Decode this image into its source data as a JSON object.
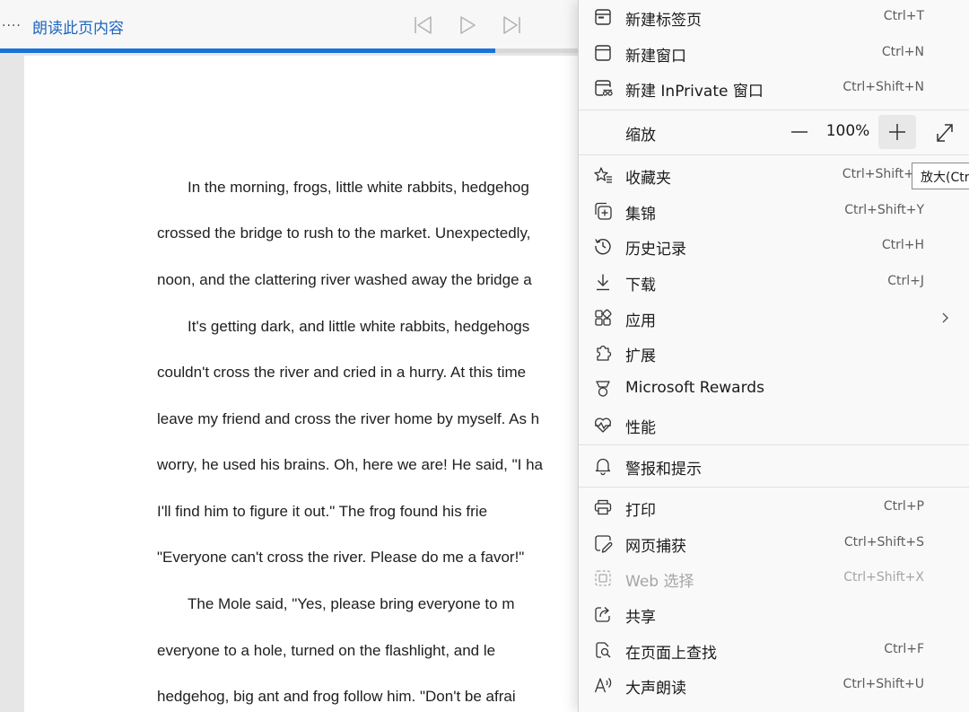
{
  "toolbar": {
    "more_label": "....",
    "read_aloud_label": "朗读此页内容",
    "progress_percent": 92
  },
  "document": {
    "lines": [
      "In the morning, frogs, little white rabbits, hedgehog",
      "crossed the bridge to rush to the market. Unexpectedly,",
      "noon, and the clattering river washed away the bridge a",
      "It's getting dark, and little white rabbits, hedgehogs",
      "couldn't cross the river and cried in a hurry. At this time",
      "leave my friend and cross the river home by myself. As h",
      "worry, he used his brains. Oh, here we are! He said, \"I ha",
      "I'll find him to figure it out.\" The frog found his frie",
      "\"Everyone can't cross the river. Please do me a favor!\"",
      "The Mole said, \"Yes, please bring everyone to m",
      "everyone to a hole, turned on the flashlight, and le",
      "hedgehog, big ant and frog follow him. \"Don't be afrai"
    ]
  },
  "menu": {
    "new_tab": {
      "label": "新建标签页",
      "shortcut": "Ctrl+T"
    },
    "new_window": {
      "label": "新建窗口",
      "shortcut": "Ctrl+N"
    },
    "new_inprivate": {
      "label": "新建 InPrivate 窗口",
      "shortcut": "Ctrl+Shift+N"
    },
    "zoom": {
      "label": "缩放",
      "value": "100%"
    },
    "favorites": {
      "label": "收藏夹",
      "shortcut": "Ctrl+Shift+"
    },
    "collections": {
      "label": "集锦",
      "shortcut": "Ctrl+Shift+Y"
    },
    "history": {
      "label": "历史记录",
      "shortcut": "Ctrl+H"
    },
    "downloads": {
      "label": "下载",
      "shortcut": "Ctrl+J"
    },
    "apps": {
      "label": "应用"
    },
    "extensions": {
      "label": "扩展"
    },
    "rewards": {
      "label": "Microsoft Rewards"
    },
    "performance": {
      "label": "性能"
    },
    "alerts": {
      "label": "警报和提示"
    },
    "print": {
      "label": "打印",
      "shortcut": "Ctrl+P"
    },
    "web_capture": {
      "label": "网页捕获",
      "shortcut": "Ctrl+Shift+S"
    },
    "web_select": {
      "label": "Web 选择",
      "shortcut": "Ctrl+Shift+X"
    },
    "share": {
      "label": "共享"
    },
    "find": {
      "label": "在页面上查找",
      "shortcut": "Ctrl+F"
    },
    "read_aloud": {
      "label": "大声朗读",
      "shortcut": "Ctrl+Shift+U"
    }
  },
  "tooltip": {
    "text": "放大(Ctr"
  },
  "colors": {
    "accent": "#1a73d9",
    "link_text": "#1e66c4",
    "menu_bg": "#f9f9f9",
    "disabled_text": "#a5a5a5"
  },
  "icons": {
    "toolbar": [
      "more-icon",
      "previous-track-icon",
      "play-icon",
      "next-track-icon"
    ],
    "menu": [
      "new-tab-icon",
      "new-window-icon",
      "inprivate-icon",
      "zoom-minus-icon",
      "zoom-plus-icon",
      "fullscreen-icon",
      "favorites-icon",
      "collections-icon",
      "history-icon",
      "download-icon",
      "apps-icon",
      "chevron-right-icon",
      "extensions-icon",
      "rewards-icon",
      "performance-icon",
      "alert-bell-icon",
      "print-icon",
      "web-capture-icon",
      "web-select-icon",
      "share-icon",
      "find-icon",
      "read-aloud-icon"
    ]
  }
}
